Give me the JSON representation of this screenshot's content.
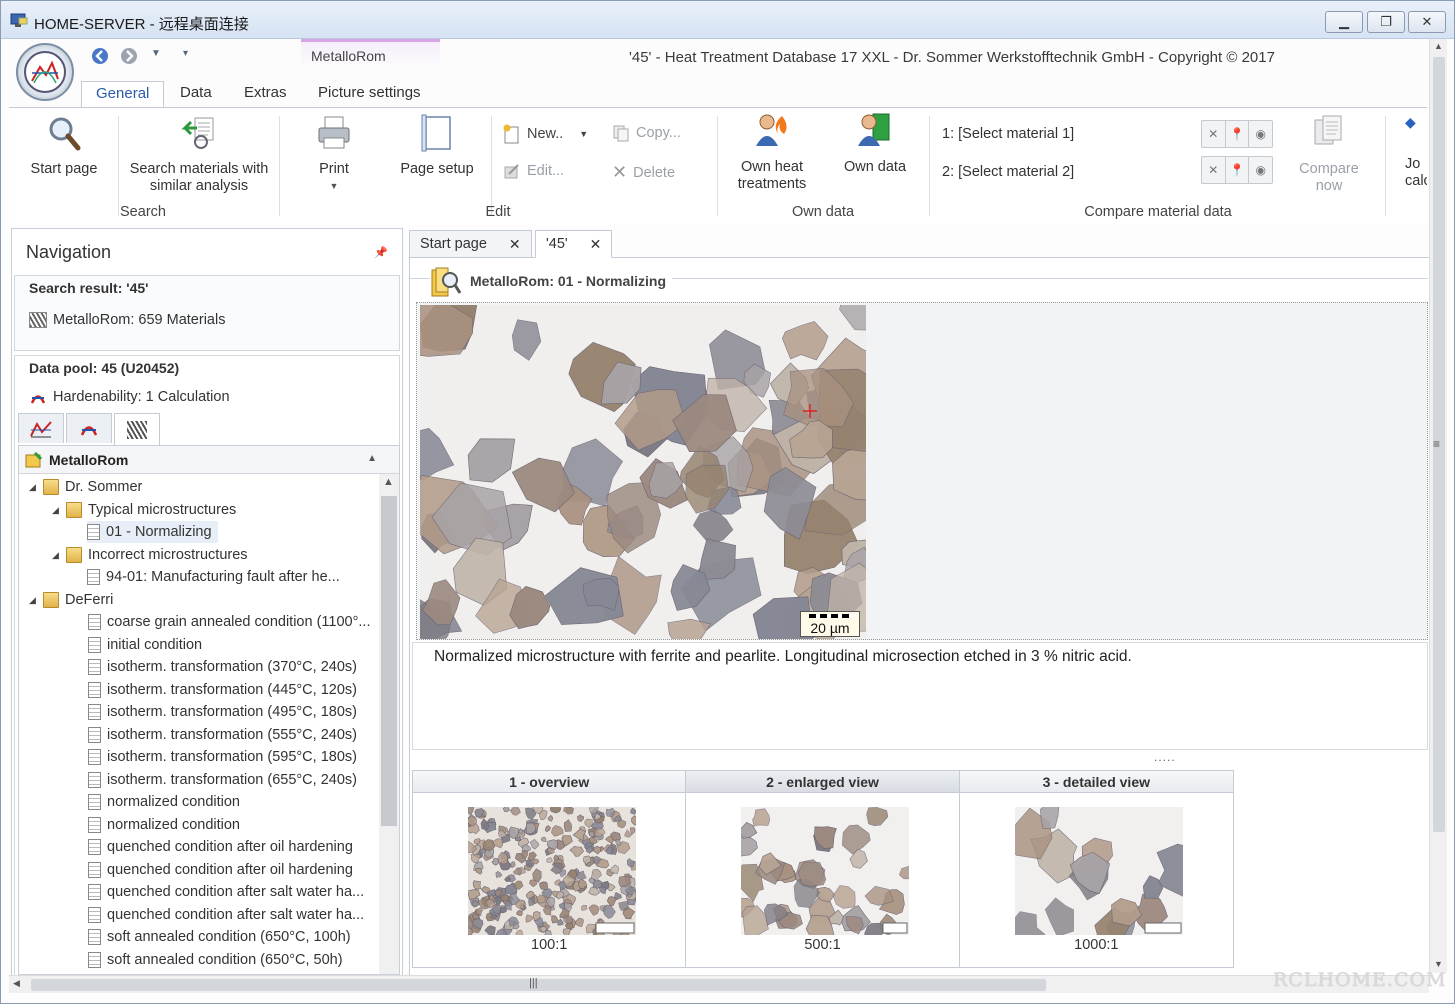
{
  "window": {
    "title": "HOME-SERVER - 远程桌面连接",
    "doc_title": "'45' - Heat Treatment Database 17 XXL - Dr. Sommer Werkstofftechnik GmbH - Copyright © 2017"
  },
  "ribbon": {
    "context_tab": "MetalloRom",
    "tabs": [
      "General",
      "Data",
      "Extras",
      "Picture settings"
    ],
    "groups": {
      "search": {
        "label": "Search",
        "start_page": "Start page",
        "search_similar_1": "Search materials with",
        "search_similar_2": "similar analysis"
      },
      "edit": {
        "label": "Edit",
        "print": "Print",
        "page_setup": "Page setup",
        "new": "New..",
        "edit": "Edit...",
        "copy": "Copy...",
        "delete": "Delete"
      },
      "own_data": {
        "label": "Own data",
        "own_heat_1": "Own heat",
        "own_heat_2": "treatments",
        "own_data": "Own data"
      },
      "compare": {
        "label": "Compare material data",
        "material1": "1:  [Select material 1]",
        "material2": "2:  [Select material 2]",
        "compare_1": "Compare",
        "compare_2": "now",
        "cut_1": "Jo",
        "cut_2": "calc"
      }
    }
  },
  "navigation": {
    "title": "Navigation",
    "search_result_header": "Search result: '45'",
    "search_result_item": "MetalloRom: 659 Materials",
    "data_pool_header": "Data pool: 45 (U20452)",
    "data_pool_item": "Hardenability: 1 Calculation",
    "tree_header": "MetalloRom",
    "tree": [
      {
        "label": "Dr. Sommer",
        "level": 0,
        "type": "folder",
        "expanded": true
      },
      {
        "label": "Typical microstructures",
        "level": 1,
        "type": "folder",
        "expanded": true
      },
      {
        "label": "01 - Normalizing",
        "level": 2,
        "type": "doc",
        "selected": true
      },
      {
        "label": "Incorrect microstructures",
        "level": 1,
        "type": "folder",
        "expanded": true
      },
      {
        "label": "94-01: Manufacturing fault after he...",
        "level": 2,
        "type": "doc"
      },
      {
        "label": "DeFerri",
        "level": 0,
        "type": "folder",
        "expanded": true
      },
      {
        "label": "coarse grain annealed condition (1100°...",
        "level": 1,
        "type": "doc"
      },
      {
        "label": "initial condition",
        "level": 1,
        "type": "doc"
      },
      {
        "label": "isotherm. transformation (370°C, 240s)",
        "level": 1,
        "type": "doc"
      },
      {
        "label": "isotherm. transformation (445°C, 120s)",
        "level": 1,
        "type": "doc"
      },
      {
        "label": "isotherm. transformation (495°C, 180s)",
        "level": 1,
        "type": "doc"
      },
      {
        "label": "isotherm. transformation (555°C, 240s)",
        "level": 1,
        "type": "doc"
      },
      {
        "label": "isotherm. transformation (595°C, 180s)",
        "level": 1,
        "type": "doc"
      },
      {
        "label": "isotherm. transformation (655°C, 240s)",
        "level": 1,
        "type": "doc"
      },
      {
        "label": "normalized condition",
        "level": 1,
        "type": "doc"
      },
      {
        "label": "normalized condition",
        "level": 1,
        "type": "doc"
      },
      {
        "label": "quenched condition after oil hardening",
        "level": 1,
        "type": "doc"
      },
      {
        "label": "quenched condition after oil hardening",
        "level": 1,
        "type": "doc"
      },
      {
        "label": "quenched condition after salt water ha...",
        "level": 1,
        "type": "doc"
      },
      {
        "label": "quenched condition after salt water ha...",
        "level": 1,
        "type": "doc"
      },
      {
        "label": "soft annealed condition (650°C, 100h)",
        "level": 1,
        "type": "doc"
      },
      {
        "label": "soft annealed condition (650°C, 50h)",
        "level": 1,
        "type": "doc"
      }
    ]
  },
  "document_tabs": [
    {
      "label": "Start page",
      "active": false
    },
    {
      "label": "'45'",
      "active": true
    }
  ],
  "content": {
    "title": "MetalloRom: 01 - Normalizing",
    "scale_bar": "20 µm",
    "caption": "Normalized microstructure with ferrite and pearlite. Longitudinal microsection etched in 3 % nitric acid.",
    "dots": ".....",
    "thumbnails": [
      {
        "header": "1 - overview",
        "label": "100:1"
      },
      {
        "header": "2 - enlarged view",
        "label": "500:1"
      },
      {
        "header": "3 - detailed view",
        "label": "1000:1"
      }
    ]
  },
  "watermark": "RCLHOME.COM"
}
